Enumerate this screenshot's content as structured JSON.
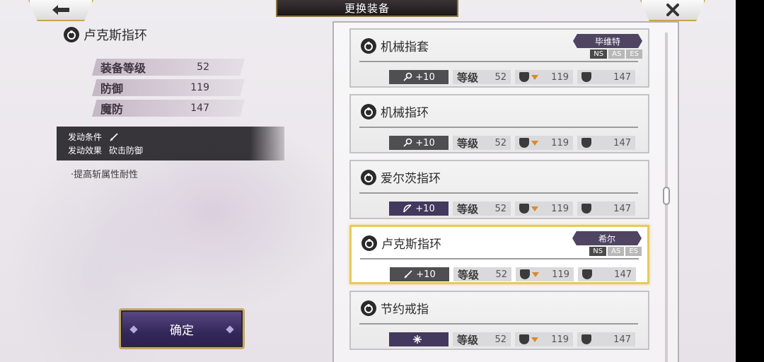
{
  "header": {
    "title": "更换装备"
  },
  "detail": {
    "name": "卢克斯指环",
    "stats": [
      {
        "label": "装备等级",
        "value": "52"
      },
      {
        "label": "防御",
        "value": "119"
      },
      {
        "label": "魔防",
        "value": "147"
      }
    ],
    "condition_label": "发动条件",
    "effect_label": "发动效果",
    "effect_value": "砍击防御",
    "description": "·提高斩属性耐性",
    "confirm_label": "确定"
  },
  "list": [
    {
      "name": "机械指套",
      "owner": "毕维特",
      "tags": [
        "NS",
        "AS",
        "ES"
      ],
      "refine": "+10",
      "level_label": "等级",
      "level": "52",
      "def": "119",
      "mdef": "147",
      "selected": false,
      "refine_icon": "mace-icon"
    },
    {
      "name": "机械指环",
      "owner": null,
      "tags": [],
      "refine": "+10",
      "level_label": "等级",
      "level": "52",
      "def": "119",
      "mdef": "147",
      "selected": false,
      "refine_icon": "mace-icon"
    },
    {
      "name": "爱尔茨指环",
      "owner": null,
      "tags": [],
      "refine": "+10",
      "level_label": "等级",
      "level": "52",
      "def": "119",
      "mdef": "147",
      "selected": false,
      "refine_icon": "bow-icon"
    },
    {
      "name": "卢克斯指环",
      "owner": "希尔",
      "tags": [
        "NS",
        "AS",
        "ES"
      ],
      "refine": "+10",
      "level_label": "等级",
      "level": "52",
      "def": "119",
      "mdef": "147",
      "selected": true,
      "refine_icon": "sword-icon"
    },
    {
      "name": "节约戒指",
      "owner": null,
      "tags": [],
      "refine": "",
      "level_label": "等级",
      "level": "52",
      "def": "119",
      "mdef": "147",
      "selected": false,
      "refine_icon": "spark-icon"
    }
  ]
}
